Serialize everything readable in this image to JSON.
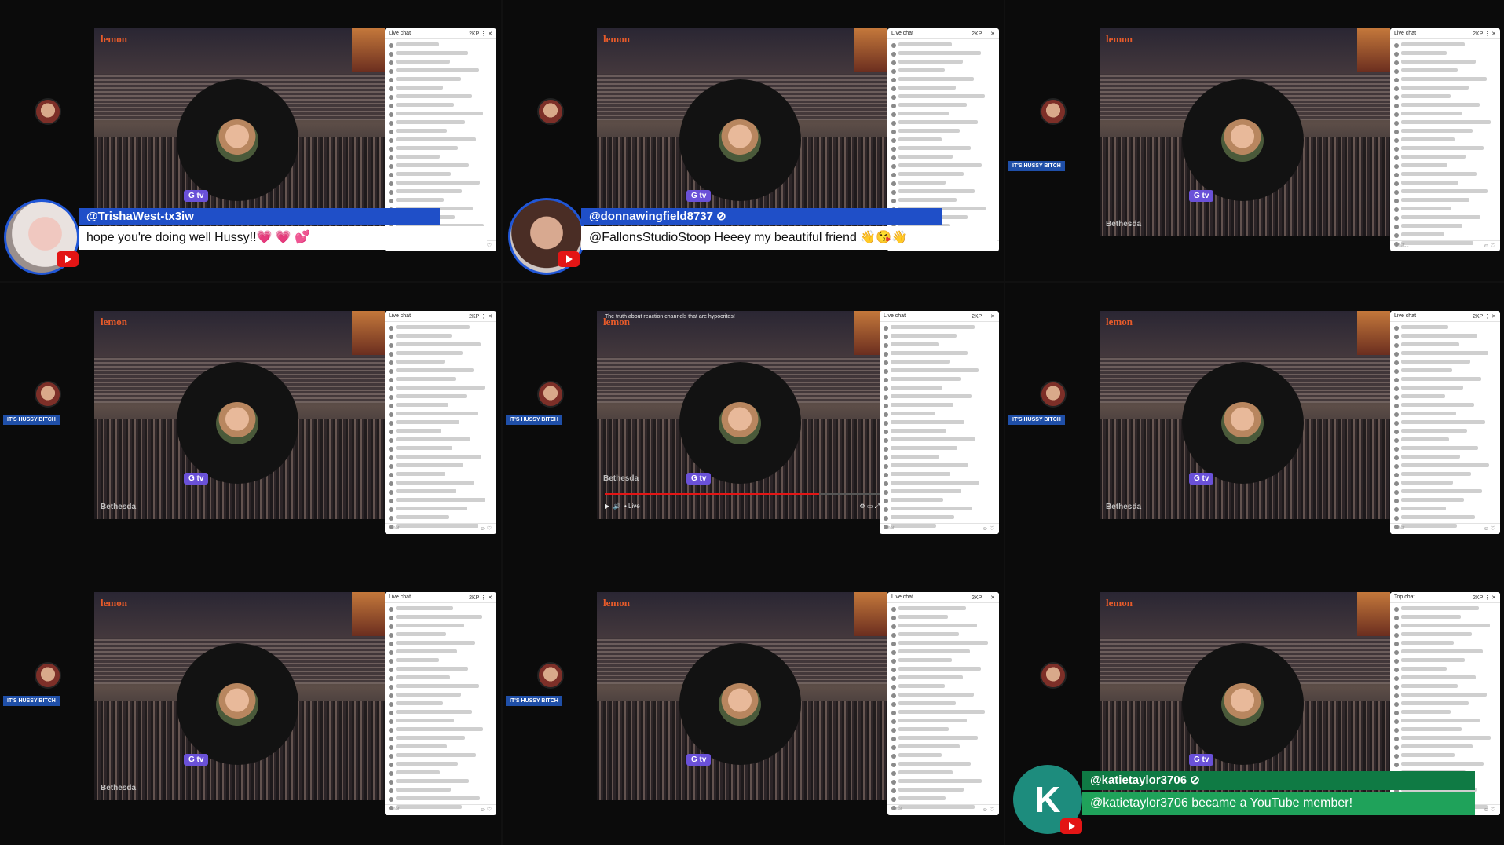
{
  "stream": {
    "brand": "lemon",
    "gtv_label": "G tv",
    "watermark": "Bethesda",
    "side_badge": "IT'S HUSSY BITCH"
  },
  "chat": {
    "header_label": "Live chat",
    "top_chat_label": "Top chat",
    "header_count": "2KP",
    "input_placeholder": "Chat..."
  },
  "video_title": "The truth about reaction channels that are hypocrites!",
  "player": {
    "live_label": "• Live"
  },
  "overlays": [
    {
      "username": "@TrishaWest-tx3iw",
      "message": "hope you're doing well Hussy!!💗 💗 💕"
    },
    {
      "username": "@donnawingfield8737 ⊘",
      "message": "@FallonsStudioStoop Heeey my beautiful friend 👋😘👋"
    }
  ],
  "membership": {
    "avatar_letter": "K",
    "username": "@katietaylor3706 ⊘",
    "message": "@katietaylor3706 became a YouTube member!"
  },
  "colors": {
    "overlay_blue": "#1f4fc8",
    "member_green": "#1fa25a",
    "gtv_purple": "#6a51d8",
    "youtube_red": "#e31515"
  }
}
